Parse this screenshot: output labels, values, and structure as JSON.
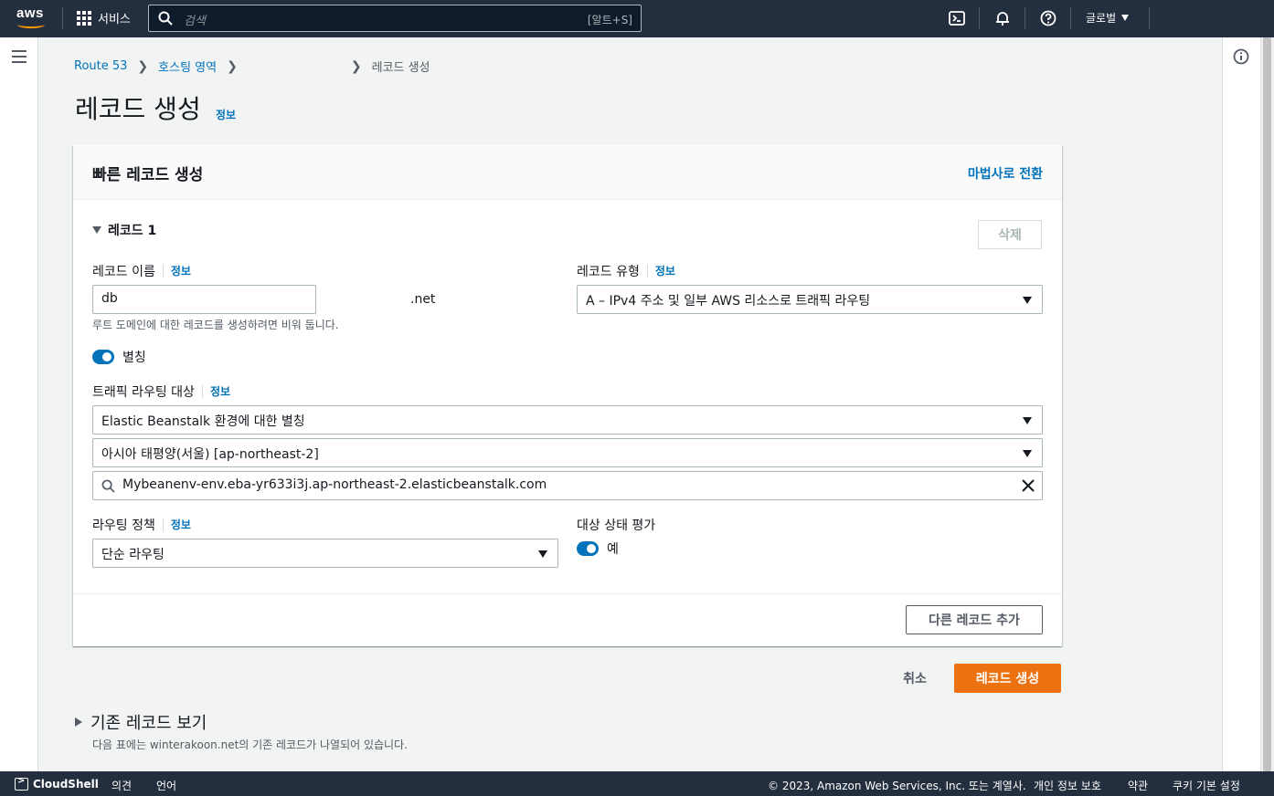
{
  "nav": {
    "logo": "aws",
    "services": "서비스",
    "search_placeholder": "검색",
    "search_shortcut": "[알트+S]",
    "region": "글로벌"
  },
  "breadcrumb": {
    "items": [
      "Route 53",
      "호스팅 영역",
      ""
    ],
    "current": "레코드 생성"
  },
  "page": {
    "title": "레코드 생성",
    "info": "정보"
  },
  "panel": {
    "title": "빠른 레코드 생성",
    "wizard_link": "마법사로 전환",
    "record_heading": "레코드 1",
    "delete_button": "삭제",
    "record_name_label": "레코드 이름",
    "record_name_info": "정보",
    "record_name_value": "db",
    "domain_suffix": ".net",
    "record_name_hint": "루트 도메인에 대한 레코드를 생성하려면 비워 둡니다.",
    "record_type_label": "레코드 유형",
    "record_type_info": "정보",
    "record_type_value": "A – IPv4 주소 및 일부 AWS 리소스로 트래픽 라우팅",
    "alias_label": "별칭",
    "alias_enabled": true,
    "target_label": "트래픽 라우팅 대상",
    "target_info": "정보",
    "target_type": "Elastic Beanstalk 환경에 대한 별칭",
    "target_region": "아시아 태평양(서울) [ap-northeast-2]",
    "target_endpoint": "Mybeanenv-env.eba-yr633i3j.ap-northeast-2.elasticbeanstalk.com",
    "routing_policy_label": "라우팅 정책",
    "routing_policy_info": "정보",
    "routing_policy_value": "단순 라우팅",
    "health_label": "대상 상태 평가",
    "health_value": "예",
    "health_enabled": true,
    "add_record_button": "다른 레코드 추가"
  },
  "actions": {
    "cancel": "취소",
    "create": "레코드 생성"
  },
  "existing": {
    "title": "기존 레코드 보기",
    "description": "다음 표에는 winterakoon.net의 기존 레코드가 나열되어 있습니다."
  },
  "footer": {
    "cloudshell": "CloudShell",
    "feedback": "의견",
    "language": "언어",
    "copyright": "© 2023, Amazon Web Services, Inc. 또는 계열사.",
    "privacy": "개인 정보 보호",
    "terms": "약관",
    "cookies": "쿠키 기본 설정"
  },
  "colors": {
    "nav_bg": "#232f3e",
    "link": "#0073bb",
    "primary_button": "#ec7211",
    "toggle_on": "#0073bb"
  }
}
